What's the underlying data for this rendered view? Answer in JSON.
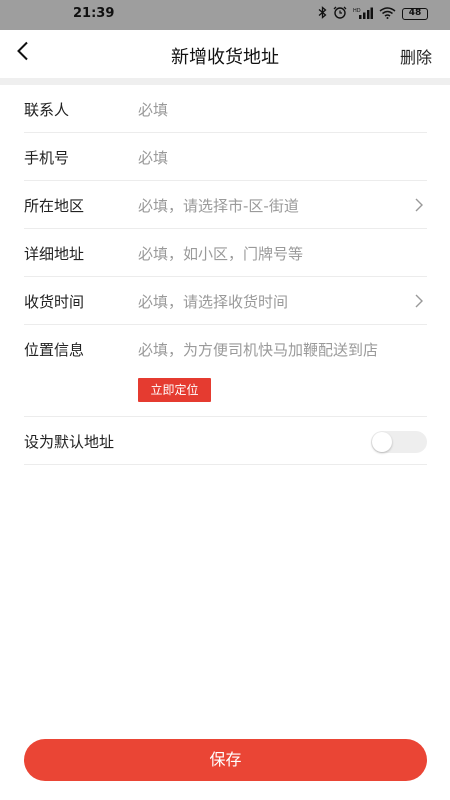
{
  "status_bar": {
    "time": "21:39",
    "battery": "48",
    "icons": [
      "bluetooth-icon",
      "alarm-icon",
      "signal-icon",
      "wifi-icon",
      "battery-icon"
    ]
  },
  "header": {
    "title": "新增收货地址",
    "delete_label": "删除",
    "back_icon": "chevron-left-icon"
  },
  "form": {
    "contact": {
      "label": "联系人",
      "placeholder": "必填"
    },
    "phone": {
      "label": "手机号",
      "placeholder": "必填"
    },
    "region": {
      "label": "所在地区",
      "placeholder": "必填，请选择市-区-街道"
    },
    "address": {
      "label": "详细地址",
      "placeholder": "必填，如小区，门牌号等"
    },
    "delivery_time": {
      "label": "收货时间",
      "placeholder": "必填，请选择收货时间"
    },
    "location": {
      "label": "位置信息",
      "placeholder": "必填，为方便司机快马加鞭配送到店",
      "locate_button": "立即定位"
    },
    "default": {
      "label": "设为默认地址",
      "enabled": false
    }
  },
  "save_label": "保存",
  "colors": {
    "accent": "#e53b30",
    "save_button": "#ea4535",
    "placeholder": "#9a9a9a"
  }
}
